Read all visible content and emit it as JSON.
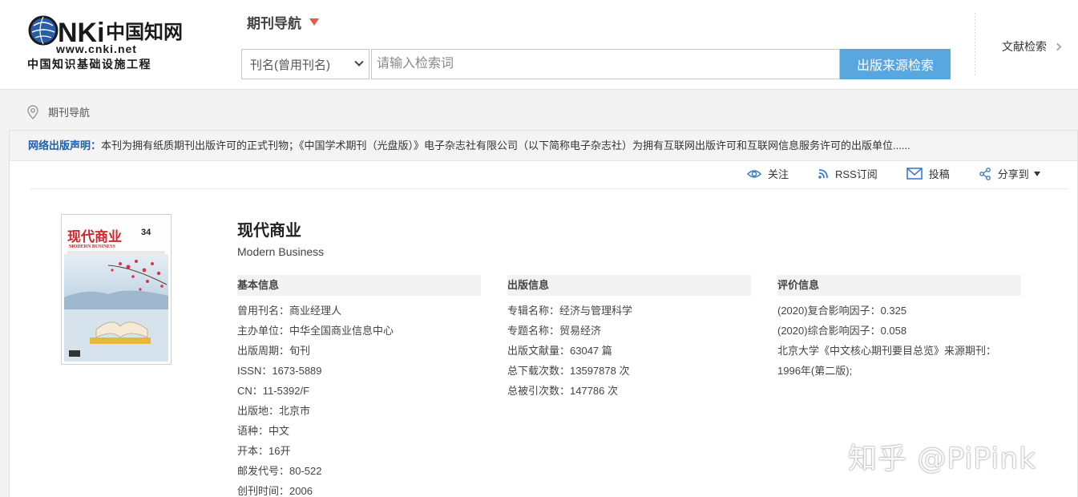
{
  "header": {
    "logo": {
      "brand_text": "CNKi中国知网",
      "url_text": "www.cnki.net",
      "tagline": "中国知识基础设施工程"
    },
    "nav_title": "期刊导航",
    "search": {
      "field_selected": "刊名(曾用刊名)",
      "placeholder": "请输入检索词",
      "button_label": "出版来源检索"
    },
    "literature_search_label": "文献检索"
  },
  "breadcrumb": {
    "label": "期刊导航"
  },
  "notice": {
    "label": "网络出版声明：",
    "text": "本刊为拥有纸质期刊出版许可的正式刊物；《中国学术期刊（光盘版）》电子杂志社有限公司（以下简称电子杂志社）为拥有互联网出版许可和互联网信息服务许可的出版单位......"
  },
  "actions": {
    "follow": "关注",
    "rss": "RSS订阅",
    "submit": "投稿",
    "share": "分享到"
  },
  "cover": {
    "title_cn": "现代商业",
    "title_en": "MODERN BUSINESS",
    "issue": "34"
  },
  "journal": {
    "title": "现代商业",
    "subtitle": "Modern Business"
  },
  "basic_info": {
    "heading": "基本信息",
    "items": [
      "曾用刊名：商业经理人",
      "主办单位：中华全国商业信息中心",
      "出版周期：旬刊",
      "ISSN：1673-5889",
      "CN：11-5392/F",
      "出版地：北京市",
      "语种：中文",
      "开本：16开",
      "邮发代号：80-522",
      "创刊时间：2006"
    ]
  },
  "publication_info": {
    "heading": "出版信息",
    "items": [
      "专辑名称：经济与管理科学",
      "专题名称：贸易经济",
      "出版文献量：63047 篇",
      "总下载次数：13597878 次",
      "总被引次数：147786 次"
    ]
  },
  "evaluation_info": {
    "heading": "评价信息",
    "items": [
      "(2020)复合影响因子：0.325",
      "(2020)综合影响因子：0.058",
      "北京大学《中文核心期刊要目总览》来源期刊：",
      "1996年(第二版);"
    ]
  },
  "watermark": "知乎 @PiPink",
  "colors": {
    "search_button": "#5aa7e0",
    "nav_caret": "#e45a4b",
    "notice_label": "#1f5ea8",
    "icon_blue": "#3a7bc8"
  }
}
